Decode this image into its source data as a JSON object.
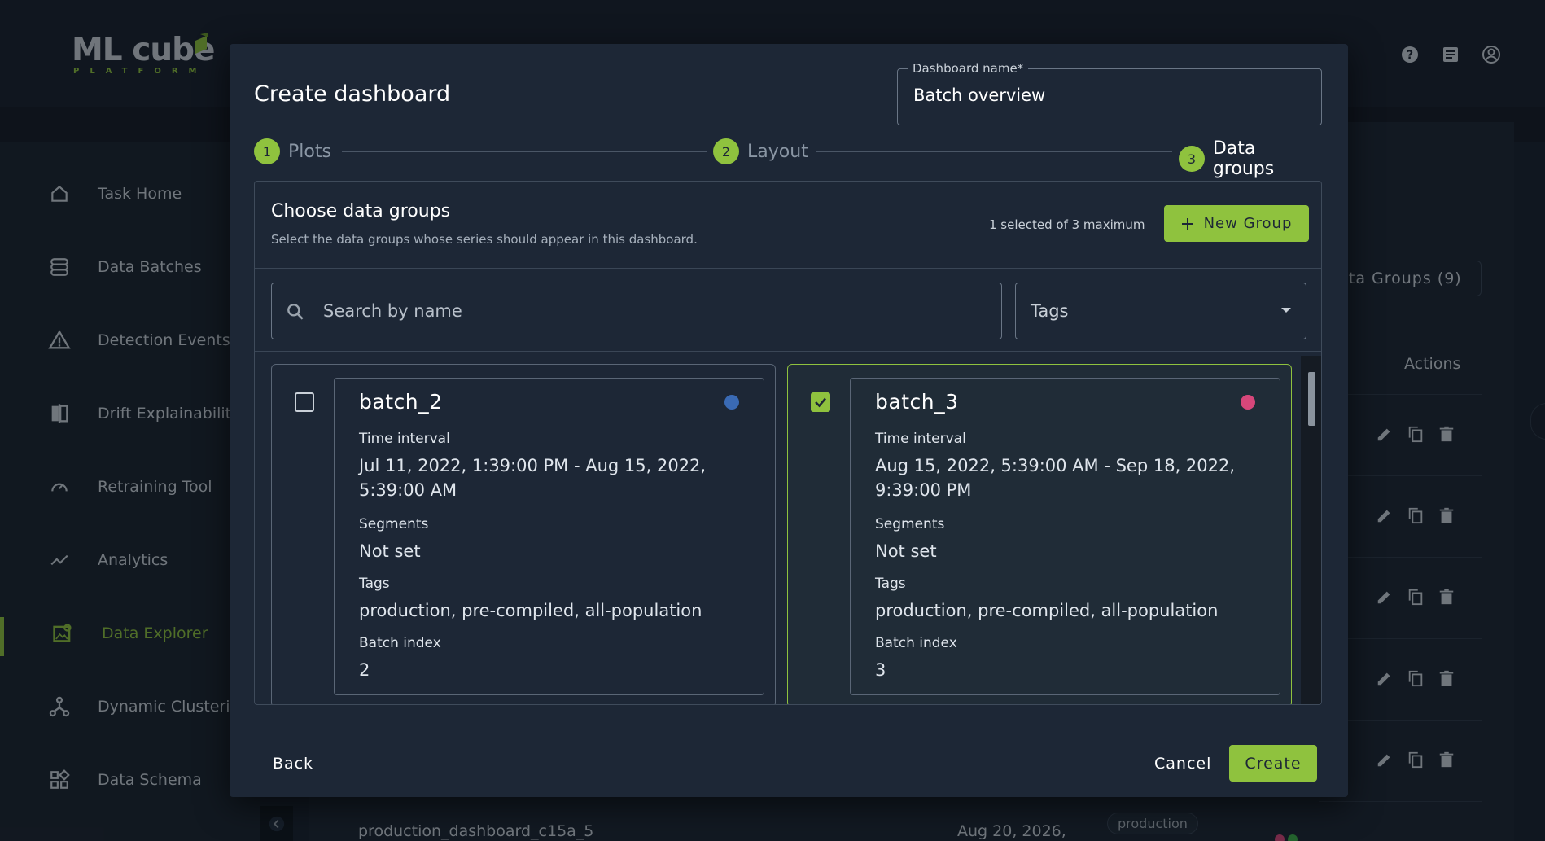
{
  "app": {
    "logo_main": "ML cube",
    "logo_sub": "PLATFORM"
  },
  "header_icons": [
    "help-icon",
    "docs-icon",
    "account-icon"
  ],
  "sidebar": {
    "items": [
      {
        "label": "Task Home",
        "icon": "home-icon"
      },
      {
        "label": "Data Batches",
        "icon": "database-icon"
      },
      {
        "label": "Detection Events",
        "icon": "warning-icon"
      },
      {
        "label": "Drift Explainability",
        "icon": "compare-icon"
      },
      {
        "label": "Retraining Tool",
        "icon": "speedometer-icon"
      },
      {
        "label": "Analytics",
        "icon": "chart-line-icon"
      },
      {
        "label": "Data Explorer",
        "icon": "image-search-icon",
        "active": true
      },
      {
        "label": "Dynamic Clusterin",
        "icon": "cluster-icon"
      },
      {
        "label": "Data Schema",
        "icon": "schema-icon"
      }
    ]
  },
  "background": {
    "groups_pill": "ata Groups (9)",
    "actions_header": "Actions",
    "bottom_row": {
      "name": "production_dashboard_c15a_5",
      "date": "Aug 20, 2026,",
      "tag": "production"
    }
  },
  "modal": {
    "title": "Create dashboard",
    "name_field": {
      "label": "Dashboard name*",
      "value": "Batch overview"
    },
    "steps": [
      {
        "num": "1",
        "label": "Plots"
      },
      {
        "num": "2",
        "label": "Layout"
      },
      {
        "num": "3",
        "label": "Data groups",
        "active": true
      }
    ],
    "panel": {
      "title": "Choose data groups",
      "subtitle": "Select the data groups whose series should appear in this dashboard.",
      "selection_count": "1 selected of 3 maximum",
      "new_group_label": "New Group",
      "search_placeholder": "Search by name",
      "tags_placeholder": "Tags"
    },
    "groups": [
      {
        "name": "batch_2",
        "selected": false,
        "color": "#3a6ab4",
        "time_interval_label": "Time interval",
        "time_interval": "Jul 11, 2022, 1:39:00 PM - Aug 15, 2022, 5:39:00 AM",
        "segments_label": "Segments",
        "segments": "Not set",
        "tags_label": "Tags",
        "tags": "production, pre-compiled, all-population",
        "batch_index_label": "Batch index",
        "batch_index": "2"
      },
      {
        "name": "batch_3",
        "selected": true,
        "color": "#d6477a",
        "time_interval_label": "Time interval",
        "time_interval": "Aug 15, 2022, 5:39:00 AM - Sep 18, 2022, 9:39:00 PM",
        "segments_label": "Segments",
        "segments": "Not set",
        "tags_label": "Tags",
        "tags": "production, pre-compiled, all-population",
        "batch_index_label": "Batch index",
        "batch_index": "3"
      }
    ],
    "footer": {
      "back": "Back",
      "cancel": "Cancel",
      "create": "Create"
    }
  },
  "colors": {
    "accent": "#8fc23e",
    "modal_bg": "#1d2736"
  }
}
